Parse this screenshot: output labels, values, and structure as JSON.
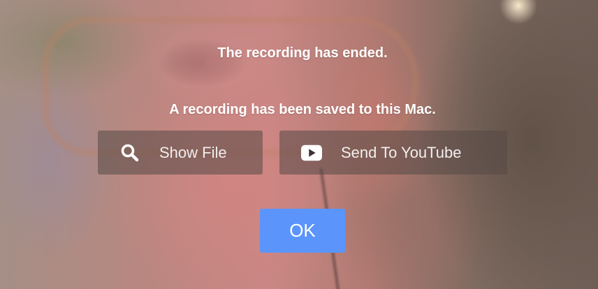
{
  "dialog": {
    "title_message": "The recording has ended.",
    "saved_message": "A recording has been saved to this Mac.",
    "actions": [
      {
        "label": "Show File",
        "icon": "search-icon"
      },
      {
        "label": "Send To YouTube",
        "icon": "youtube-play-icon"
      }
    ],
    "ok_label": "OK"
  },
  "colors": {
    "ok_button": "#5b95fb",
    "action_button_bg": "rgba(85,72,70,0.55)",
    "text": "#ffffff"
  }
}
